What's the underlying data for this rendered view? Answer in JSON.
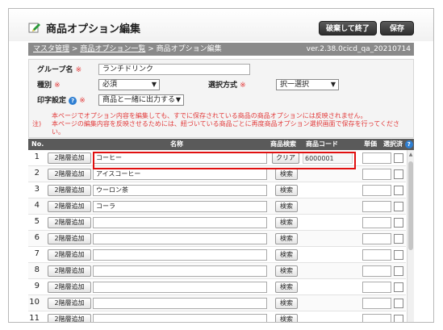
{
  "header": {
    "title": "商品オプション編集",
    "close_button": "破棄して終了",
    "save_button": "保存",
    "icon": "edit-pencil-icon"
  },
  "breadcrumb": {
    "items": [
      "マスタ管理",
      "商品オプション一覧"
    ],
    "separator": ">",
    "current": "商品オプション編集",
    "version": "ver.2.38.0cicd_qa_20210714"
  },
  "form": {
    "group_name_label": "グループ名",
    "group_name_value": "ランチドリンク",
    "type_label": "種別",
    "type_value": "必須",
    "method_label": "選択方式",
    "method_value": "択一選択",
    "print_label": "印字設定",
    "print_value": "商品と一緒に出力する",
    "required_mark": "※",
    "note_mark": "注)",
    "note_line1": "本ページでオプション内容を編集しても、すでに保存されている商品の商品オプションには反映されません。",
    "note_line2": "本ページの編集内容を反映させるためには、紐づいている商品ごとに再度商品オプション選択画面で保存を行ってください。"
  },
  "grid": {
    "headers": {
      "no": "No.",
      "name": "名称",
      "search": "商品検索",
      "code": "商品コード",
      "price": "単価",
      "selected": "選択済"
    },
    "add_label": "2階層追加",
    "search_label": "検索",
    "clear_label": "クリア",
    "rows": [
      {
        "no": "1",
        "name": "コーヒー",
        "code": "6000001",
        "action": "クリア"
      },
      {
        "no": "2",
        "name": "アイスコーヒー",
        "code": "",
        "action": "検索"
      },
      {
        "no": "3",
        "name": "ウーロン茶",
        "code": "",
        "action": "検索"
      },
      {
        "no": "4",
        "name": "コーラ",
        "code": "",
        "action": "検索"
      },
      {
        "no": "5",
        "name": "",
        "code": "",
        "action": "検索"
      },
      {
        "no": "6",
        "name": "",
        "code": "",
        "action": "検索"
      },
      {
        "no": "7",
        "name": "",
        "code": "",
        "action": "検索"
      },
      {
        "no": "8",
        "name": "",
        "code": "",
        "action": "検索"
      },
      {
        "no": "9",
        "name": "",
        "code": "",
        "action": "検索"
      },
      {
        "no": "10",
        "name": "",
        "code": "",
        "action": "検索"
      },
      {
        "no": "11",
        "name": "",
        "code": "",
        "action": "検索"
      }
    ]
  },
  "colors": {
    "accent_red": "#e01010",
    "header_dark": "#5a5a5a",
    "breadcrumb_gray": "#8a8a8a",
    "help_blue": "#2f7fd2"
  }
}
